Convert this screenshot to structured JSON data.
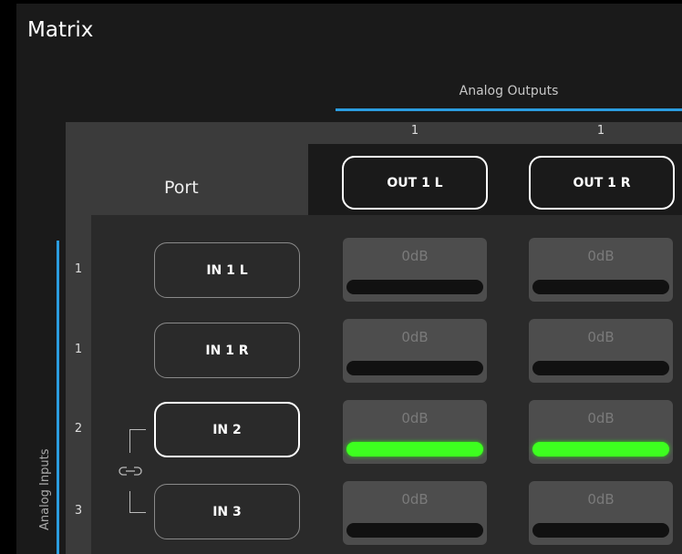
{
  "page": {
    "title": "Matrix"
  },
  "outputs": {
    "group_title": "Analog Outputs",
    "columns": [
      {
        "index": "1",
        "label": "OUT 1 L"
      },
      {
        "index": "1",
        "label": "OUT 1 R"
      }
    ]
  },
  "port_label": "Port",
  "inputs": {
    "group_title": "Analog Inputs",
    "rows": [
      {
        "index": "1",
        "label": "IN 1 L",
        "selected": false
      },
      {
        "index": "1",
        "label": "IN 1 R",
        "selected": false
      },
      {
        "index": "2",
        "label": "IN 2",
        "selected": true
      },
      {
        "index": "3",
        "label": "IN 3",
        "selected": false
      }
    ]
  },
  "crosspoints": [
    [
      {
        "gain": "0dB",
        "connected": false
      },
      {
        "gain": "0dB",
        "connected": false
      }
    ],
    [
      {
        "gain": "0dB",
        "connected": false
      },
      {
        "gain": "0dB",
        "connected": false
      }
    ],
    [
      {
        "gain": "0dB",
        "connected": true
      },
      {
        "gain": "0dB",
        "connected": true
      }
    ],
    [
      {
        "gain": "0dB",
        "connected": false
      },
      {
        "gain": "0dB",
        "connected": false
      }
    ]
  ],
  "icons": {
    "link": "link-icon"
  },
  "colors": {
    "accent": "#2b9de0",
    "active_level": "#3dff1f"
  }
}
